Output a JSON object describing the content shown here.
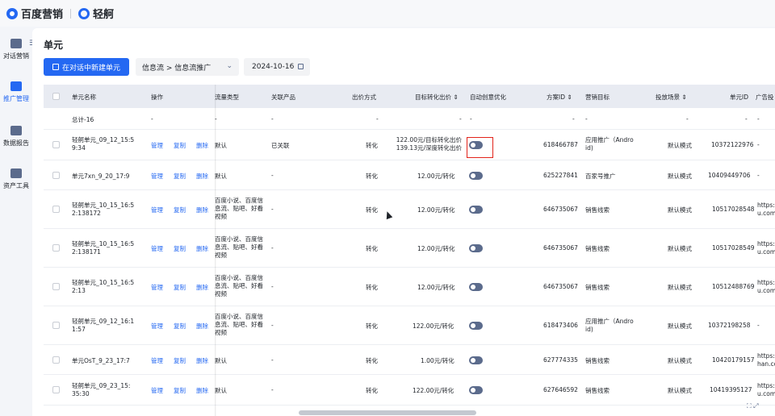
{
  "brand": {
    "baidu": "百度营销",
    "qingge": "轻舸"
  },
  "nav": [
    {
      "label": "对话营销",
      "icon": "chat-icon"
    },
    {
      "label": "推广管理",
      "icon": "chart-icon",
      "active": true
    },
    {
      "label": "数据报告",
      "icon": "report-icon"
    },
    {
      "label": "资产工具",
      "icon": "toolbox-icon"
    }
  ],
  "page": {
    "title": "单元",
    "new_button": "在对话中新建单元",
    "flow_select": "信息流 > 信息流推广",
    "date": "2024-10-16"
  },
  "table": {
    "headers": {
      "name": "单元名称",
      "ops": "操作",
      "traffic": "流量类型",
      "product": "关联产品",
      "bid": "出价方式",
      "target": "目标转化出价 ⇕",
      "auto": "自动创意优化",
      "plan": "方案ID ⇕",
      "goal": "营销目标",
      "scene": "投放场景 ⇕",
      "unit": "单元ID",
      "ad": "广告投"
    },
    "total": {
      "name": "总计-16",
      "ops": "-",
      "traffic": "-",
      "product": "-",
      "bid": "-",
      "target": "-",
      "auto": "-",
      "plan": "-",
      "goal": "-",
      "scene": "-",
      "unit": "-",
      "ad": "-"
    },
    "op_labels": {
      "manage": "管理",
      "copy": "复制",
      "delete": "删除"
    },
    "rows": [
      {
        "name": "轻舸单元_09_12_15:5 9:34",
        "traffic": "默认",
        "product": "已关联",
        "bid": "转化",
        "target": "122.00元/目标转化出价 139.13元/深度转化出价",
        "plan": "618466787",
        "goal": "应用推广（Andro id)",
        "scene": "默认模式",
        "unit": "10372122976",
        "ad": "-"
      },
      {
        "name": "单元7xn_9_20_17:9",
        "traffic": "默认",
        "product": "-",
        "bid": "转化",
        "target": "12.00元/转化",
        "plan": "625227841",
        "goal": "百家号推广",
        "scene": "默认模式",
        "unit": "10409449706",
        "ad": "-"
      },
      {
        "name": "轻舸单元_10_15_16:5 2:138172",
        "traffic": "百度小说、百度信 息流、贴吧、好看 视频",
        "product": "-",
        "bid": "转化",
        "target": "12.00元/转化",
        "plan": "646735067",
        "goal": "销售线索",
        "scene": "默认模式",
        "unit": "10517028548",
        "ad": "https: u.com"
      },
      {
        "name": "轻舸单元_10_15_16:5 2:138171",
        "traffic": "百度小说、百度信 息流、贴吧、好看 视频",
        "product": "-",
        "bid": "转化",
        "target": "12.00元/转化",
        "plan": "646735067",
        "goal": "销售线索",
        "scene": "默认模式",
        "unit": "10517028549",
        "ad": "https: u.com"
      },
      {
        "name": "轻舸单元_10_15_16:5 2:13",
        "traffic": "百度小说、百度信 息流、贴吧、好看 视频",
        "product": "-",
        "bid": "转化",
        "target": "12.00元/转化",
        "plan": "646735067",
        "goal": "销售线索",
        "scene": "默认模式",
        "unit": "10512488769",
        "ad": "https: u.com"
      },
      {
        "name": "轻舸单元_09_12_16:1 1:57",
        "traffic": "百度小说、百度信 息流、贴吧、好看 视频",
        "product": "-",
        "bid": "转化",
        "target": "122.00元/转化",
        "plan": "618473406",
        "goal": "应用推广（Andro id)",
        "scene": "默认模式",
        "unit": "10372198258",
        "ad": "-"
      },
      {
        "name": "单元OsT_9_23_17:7",
        "traffic": "默认",
        "product": "-",
        "bid": "转化",
        "target": "1.00元/转化",
        "plan": "627774335",
        "goal": "销售线索",
        "scene": "默认模式",
        "unit": "10420179157",
        "ad": "https: han.co"
      },
      {
        "name": "轻舸单元_09_23_15: 35:30",
        "traffic": "默认",
        "product": "-",
        "bid": "转化",
        "target": "122.00元/转化",
        "plan": "627646592",
        "goal": "销售线索",
        "scene": "默认模式",
        "unit": "10419395127",
        "ad": "https: u.com"
      }
    ]
  }
}
